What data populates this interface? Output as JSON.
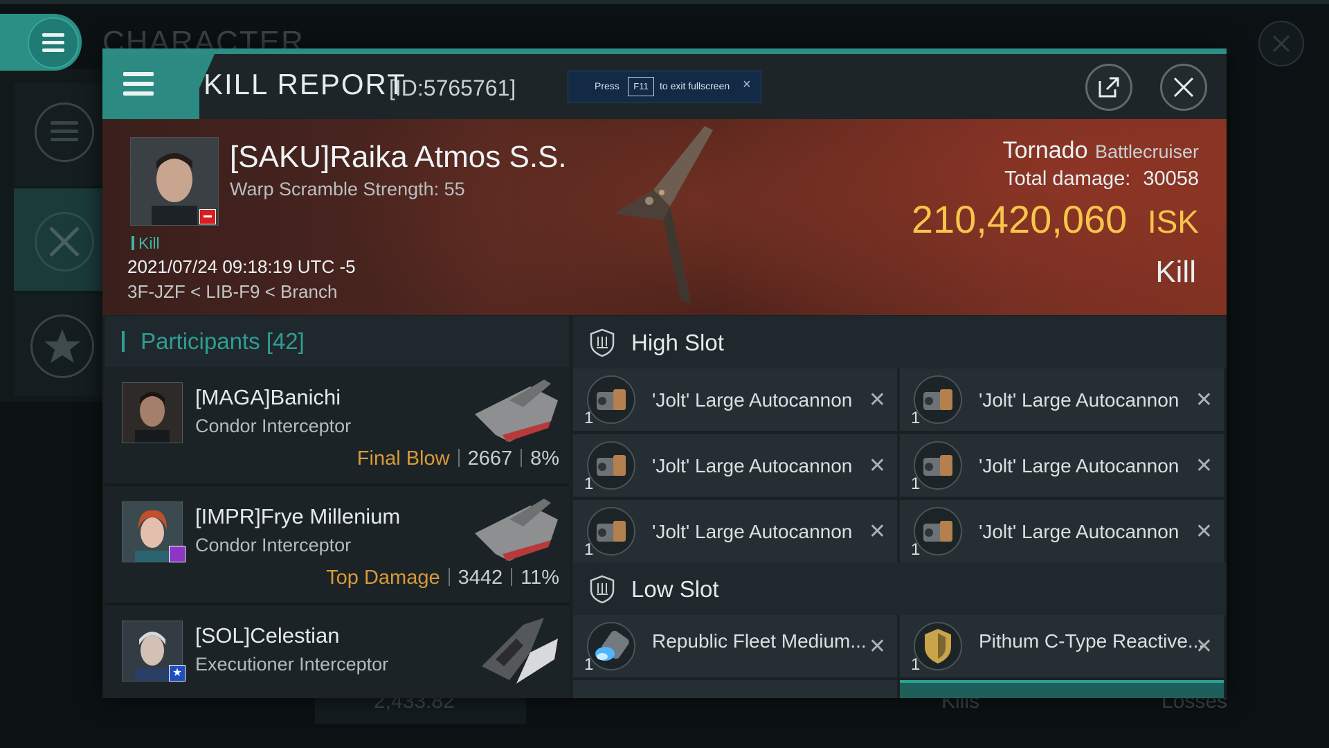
{
  "background": {
    "title": "CHARACTER",
    "balance": "2,433.82",
    "kills_tab": "Kills",
    "losses_tab": "Losses"
  },
  "modal": {
    "title": "KILL REPORT",
    "id": "[ID:5765761]",
    "fullscreen_notice": {
      "prefix": "Press",
      "key": "F11",
      "suffix": "to exit fullscreen"
    }
  },
  "victim": {
    "name": "[SAKU]Raika Atmos S.S.",
    "warp_scramble": "Warp Scramble Strength: 55",
    "tag": "Kill",
    "datetime": "2021/07/24 09:18:19 UTC -5",
    "location": "3F-JZF < LIB-F9 < Branch",
    "ship_name": "Tornado",
    "ship_class": "Battlecruiser",
    "total_damage_label": "Total damage:",
    "total_damage": "30058",
    "isk_value": "210,420,060",
    "isk_unit": "ISK",
    "result": "Kill"
  },
  "participants": {
    "title": "Participants",
    "count": "[42]",
    "items": [
      {
        "name": "[MAGA]Banichi",
        "ship": "Condor Interceptor",
        "label": "Final Blow",
        "damage": "2667",
        "percent": "8%"
      },
      {
        "name": "[IMPR]Frye Millenium",
        "ship": "Condor Interceptor",
        "label": "Top Damage",
        "damage": "3442",
        "percent": "11%"
      },
      {
        "name": "[SOL]Celestian",
        "ship": "Executioner Interceptor",
        "label": "",
        "damage": "",
        "percent": ""
      }
    ]
  },
  "fitting": {
    "high_slot_title": "High Slot",
    "low_slot_title": "Low Slot",
    "high_slot": [
      {
        "name": "'Jolt' Large Autocannon",
        "qty": "1"
      },
      {
        "name": "'Jolt' Large Autocannon",
        "qty": "1"
      },
      {
        "name": "'Jolt' Large Autocannon",
        "qty": "1"
      },
      {
        "name": "'Jolt' Large Autocannon",
        "qty": "1"
      },
      {
        "name": "'Jolt' Large Autocannon",
        "qty": "1"
      },
      {
        "name": "'Jolt' Large Autocannon",
        "qty": "1"
      }
    ],
    "low_slot": [
      {
        "name": "Republic Fleet Medium...",
        "qty": "1"
      },
      {
        "name": "Pithum C-Type Reactive...",
        "qty": "1"
      }
    ]
  },
  "colors": {
    "accent": "#2b8a82",
    "isk": "#f6c54a",
    "stat_label": "#d79a3a",
    "victim_badge": "#d81e1e"
  },
  "icons": [
    "hamburger-icon",
    "external-link-icon",
    "close-icon",
    "shield-slot-icon",
    "autocannon-icon",
    "armor-plate-icon",
    "star-icon",
    "crossed-swords-icon"
  ]
}
